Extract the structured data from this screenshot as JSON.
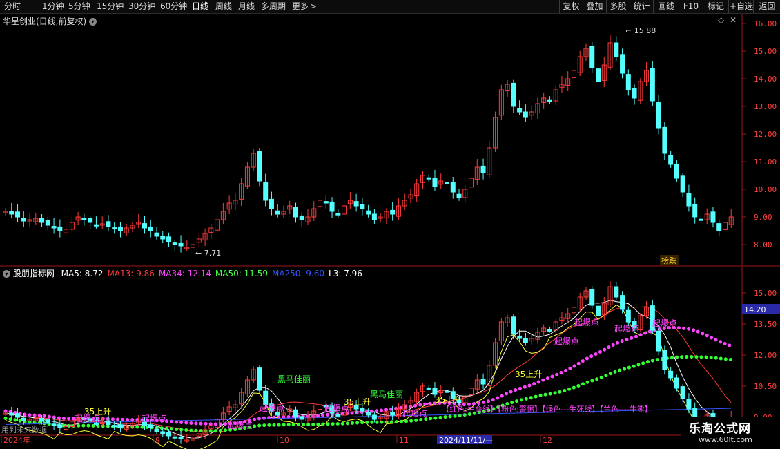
{
  "toolbar": {
    "periods": [
      "分时",
      "1分钟",
      "5分钟",
      "15分钟",
      "30分钟",
      "60分钟",
      "日线",
      "周线",
      "月线",
      "多周期",
      "更多"
    ],
    "active_period": "日线",
    "more_arrow": ">",
    "right_buttons": [
      "复权",
      "叠加",
      "多股",
      "统计",
      "画线",
      "F10",
      "+自选",
      "返回"
    ]
  },
  "main_chart": {
    "title": "华星创业(日线,前复权)",
    "y_ticks": [
      "16.00",
      "15.00",
      "14.00",
      "13.00",
      "12.00",
      "11.00",
      "10.00",
      "9.00",
      "8.00"
    ],
    "high_label": "15.88",
    "low_label": "7.71",
    "badge": "榜跌",
    "colors": {
      "up": "#ff3b3b",
      "down": "#54ffff",
      "grid": "#7a1010",
      "axis": "#a01818"
    }
  },
  "indicator": {
    "name": "股朋指标网",
    "ma_labels": [
      {
        "text": "MA5: 8.72",
        "color": "#ffffff"
      },
      {
        "text": "MA13: 9.86",
        "color": "#ff3b3b"
      },
      {
        "text": "MA34: 12.14",
        "color": "#ff44ff"
      },
      {
        "text": "MA50: 11.59",
        "color": "#44ff44"
      },
      {
        "text": "MA250: 9.60",
        "color": "#3355ff"
      },
      {
        "text": "L3: 7.96",
        "color": "#ffffff"
      }
    ],
    "y_ticks": [
      "15.00",
      "13.50",
      "12.00",
      "10.50",
      "9.00"
    ],
    "current_price_tag": "14.20",
    "signals": [
      "起爆点",
      "起爆点",
      "起爆点",
      "起爆点",
      "起爆点",
      "起爆点",
      "起爆点",
      "起爆点",
      "起爆点",
      "黑马佳丽",
      "35上升",
      "35上升",
      "35上升",
      "35上升"
    ],
    "legend": "【红色:生命线】【粉色:警惕】【绿色---生死线】【兰色----牛熊】",
    "future_label": "用到未来数据"
  },
  "time_axis": {
    "labels": [
      "2024年",
      "9",
      "10",
      "11",
      "12"
    ],
    "cursor_date": "2024/11/11/—"
  },
  "watermark": {
    "title": "乐淘公式网",
    "url": "www.60lt.com"
  }
}
